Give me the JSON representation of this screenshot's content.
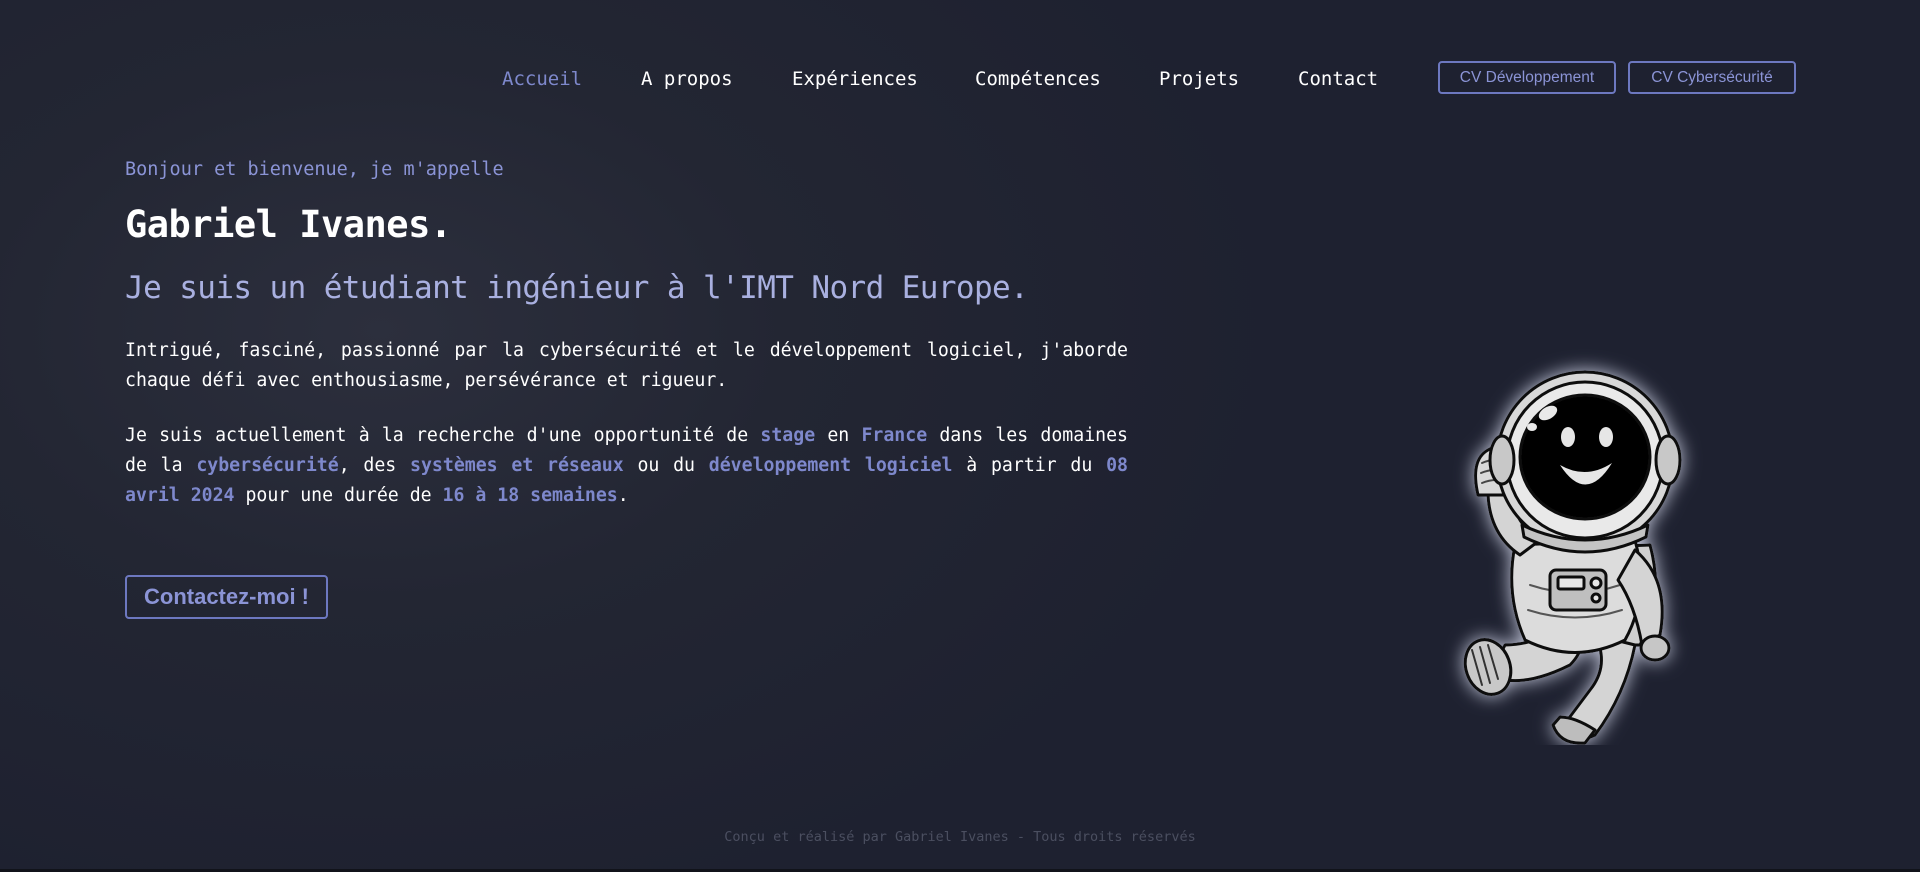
{
  "nav": {
    "items": [
      {
        "label": "Accueil"
      },
      {
        "label": "A propos"
      },
      {
        "label": "Expériences"
      },
      {
        "label": "Compétences"
      },
      {
        "label": "Projets"
      },
      {
        "label": "Contact"
      }
    ],
    "active": "Accueil",
    "cv_dev_label": "CV Développement",
    "cv_cyber_label": "CV Cybersécurité"
  },
  "hero": {
    "greeting": "Bonjour et bienvenue, je m'appelle",
    "name": "Gabriel Ivanes.",
    "subtitle": "Je suis un étudiant ingénieur à l'IMT Nord Europe.",
    "intro": "Intrigué, fasciné, passionné par la cybersécurité et le développement logiciel, j'aborde chaque défi avec enthousiasme, persévérance et rigueur.",
    "search": {
      "t1": "Je suis actuellement à la recherche d'une opportunité de ",
      "h1": "stage",
      "t2": " en ",
      "h2": "France",
      "t3": " dans les domaines de la ",
      "h3": "cybersécurité",
      "t4": ", des ",
      "h4": "systèmes et réseaux",
      "t5": " ou du ",
      "h5": "développement logiciel",
      "t6": " à partir du ",
      "h6": "08 avril 2024",
      "t7": " pour une durée de ",
      "h7": "16 à 18 semaines",
      "t8": "."
    },
    "contact_button": "Contactez-moi !"
  },
  "illustration": {
    "icon": "astronaut-icon"
  },
  "footer": {
    "text": "Conçu et réalisé par Gabriel Ivanes - Tous droits réservés"
  },
  "colors": {
    "accent": "#7e88cc",
    "background": "#232633",
    "text": "#ffffff"
  }
}
